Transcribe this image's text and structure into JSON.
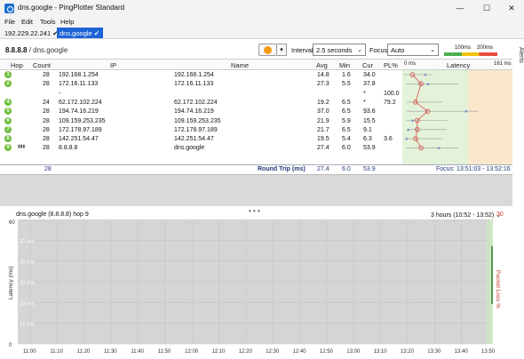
{
  "window": {
    "title": "dns.google - PingPlotter Standard",
    "min": "—",
    "max": "☐",
    "close": "✕"
  },
  "menu": [
    "File",
    "Edit",
    "Tools",
    "Help"
  ],
  "tabs": [
    {
      "label": "192.229.22.241",
      "check": "✔"
    },
    {
      "label": "dns.google",
      "check": "✔"
    }
  ],
  "alerts_label": "Alerts",
  "header": {
    "target_ip": "8.8.8.8",
    "target_sep": " / ",
    "target_name": "dns.google",
    "interval_label": "Interval",
    "interval_value": "2.5 seconds",
    "focus_label": "Focus",
    "focus_value": "Auto",
    "scale_100": "100ms",
    "scale_200": "200ms"
  },
  "columns": {
    "hop": "Hop",
    "count": "Count",
    "ip": "IP",
    "name": "Name",
    "avg": "Avg",
    "min": "Min",
    "cur": "Cur",
    "pl": "PL%",
    "lat_start": "0 ms",
    "latency": "Latency",
    "lat_end": "161 ms"
  },
  "rows": [
    {
      "hop": "1",
      "count": "28",
      "ip": "192.168.1.254",
      "name": "192.168.1.254",
      "avg": "14.8",
      "min": "1.6",
      "cur": "34.0",
      "pl": ""
    },
    {
      "hop": "2",
      "count": "28",
      "ip": "172.16.11.133",
      "name": "172.16.11.133",
      "avg": "27.3",
      "min": "5.5",
      "cur": "37.8",
      "pl": ""
    },
    {
      "hop": "3",
      "count": "",
      "ip": "-",
      "name": "",
      "avg": "",
      "min": "",
      "cur": "*",
      "pl": "100.0"
    },
    {
      "hop": "4",
      "count": "24",
      "ip": "62.172.102.224",
      "name": "62.172.102.224",
      "avg": "19.2",
      "min": "6.5",
      "cur": "*",
      "pl": "79.2"
    },
    {
      "hop": "5",
      "count": "28",
      "ip": "194.74.16.219",
      "name": "194.74.16.219",
      "avg": "37.0",
      "min": "6.5",
      "cur": "93.6",
      "pl": ""
    },
    {
      "hop": "6",
      "count": "28",
      "ip": "109.159.253.235",
      "name": "109.159.253.235",
      "avg": "21.9",
      "min": "5.9",
      "cur": "15.5",
      "pl": ""
    },
    {
      "hop": "7",
      "count": "28",
      "ip": "172.178.97.189",
      "name": "172.178.97.189",
      "avg": "21.7",
      "min": "6.5",
      "cur": "9.1",
      "pl": ""
    },
    {
      "hop": "8",
      "count": "28",
      "ip": "142.251.54.47",
      "name": "142.251.54.47",
      "avg": "19.5",
      "min": "5.4",
      "cur": "6.3",
      "pl": "3.6"
    },
    {
      "hop": "9",
      "count": "28",
      "ip": "8.8.8.8",
      "name": "dns.google",
      "avg": "27.4",
      "min": "6.0",
      "cur": "53.9",
      "pl": ""
    }
  ],
  "summary": {
    "count": "28",
    "label": "Round Trip (ms)",
    "avg": "27.4",
    "min": "6.0",
    "cur": "53.9",
    "focus": "Focus: 13:51:03 - 13:52:16"
  },
  "splitter": "• • •",
  "graph": {
    "title": "dns.google (8.8.8.8) hop 9",
    "range": "3 hours (10:52 - 13:52)",
    "range_icon": "⌄",
    "pl_max": "30",
    "y_label": "Latency (ms)",
    "pl_label": "Packet Loss %",
    "y_ticks": [
      "60",
      "50 ms",
      "40 ms",
      "30 ms",
      "20 ms",
      "10 ms",
      "0"
    ],
    "x_ticks": [
      "11:00",
      "11:10",
      "11:20",
      "11:30",
      "11:40",
      "11:50",
      "12:00",
      "12:10",
      "12:20",
      "12:30",
      "12:40",
      "12:50",
      "13:00",
      "13:10",
      "13:20",
      "13:30",
      "13:40",
      "13:50"
    ]
  }
}
